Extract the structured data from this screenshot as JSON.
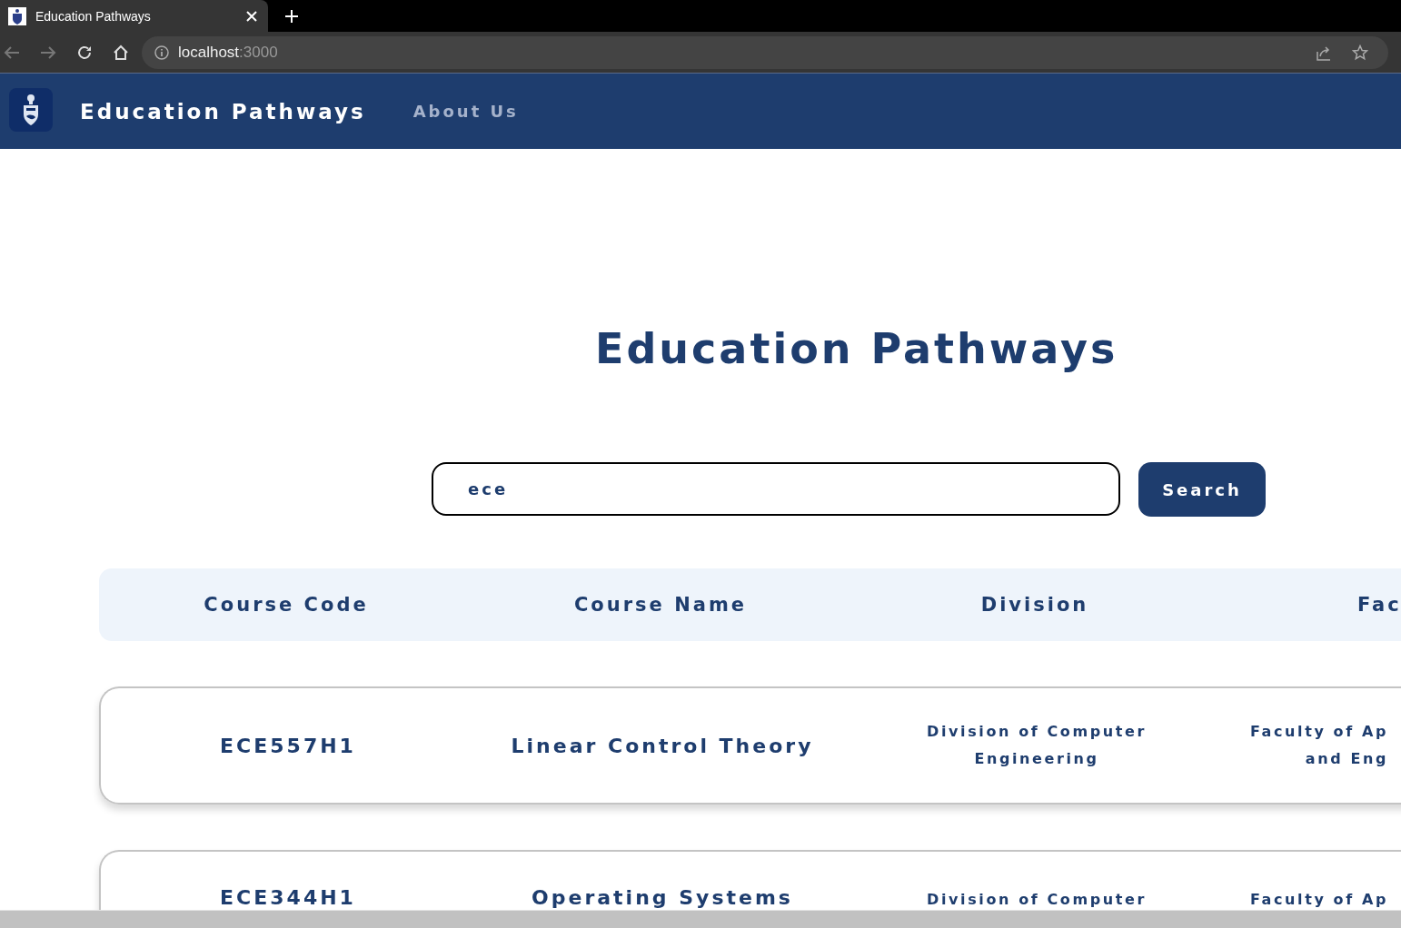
{
  "browser": {
    "tab_title": "Education Pathways",
    "url_host": "localhost",
    "url_port": ":3000"
  },
  "navbar": {
    "brand": "Education Pathways",
    "links": [
      "About Us"
    ]
  },
  "heading": "Education Pathways",
  "search": {
    "value": "ece",
    "button": "Search"
  },
  "table": {
    "columns": [
      "Course Code",
      "Course Name",
      "Division",
      "Fac"
    ],
    "rows": [
      {
        "code": "ECE557H1",
        "name": "Linear Control Theory",
        "division": "Division of Computer\nEngineering",
        "faculty": "Faculty of Ap\nand Eng"
      },
      {
        "code": "ECE344H1",
        "name": "Operating Systems",
        "division": "Division of Computer",
        "faculty": "Faculty of Ap"
      }
    ]
  }
}
